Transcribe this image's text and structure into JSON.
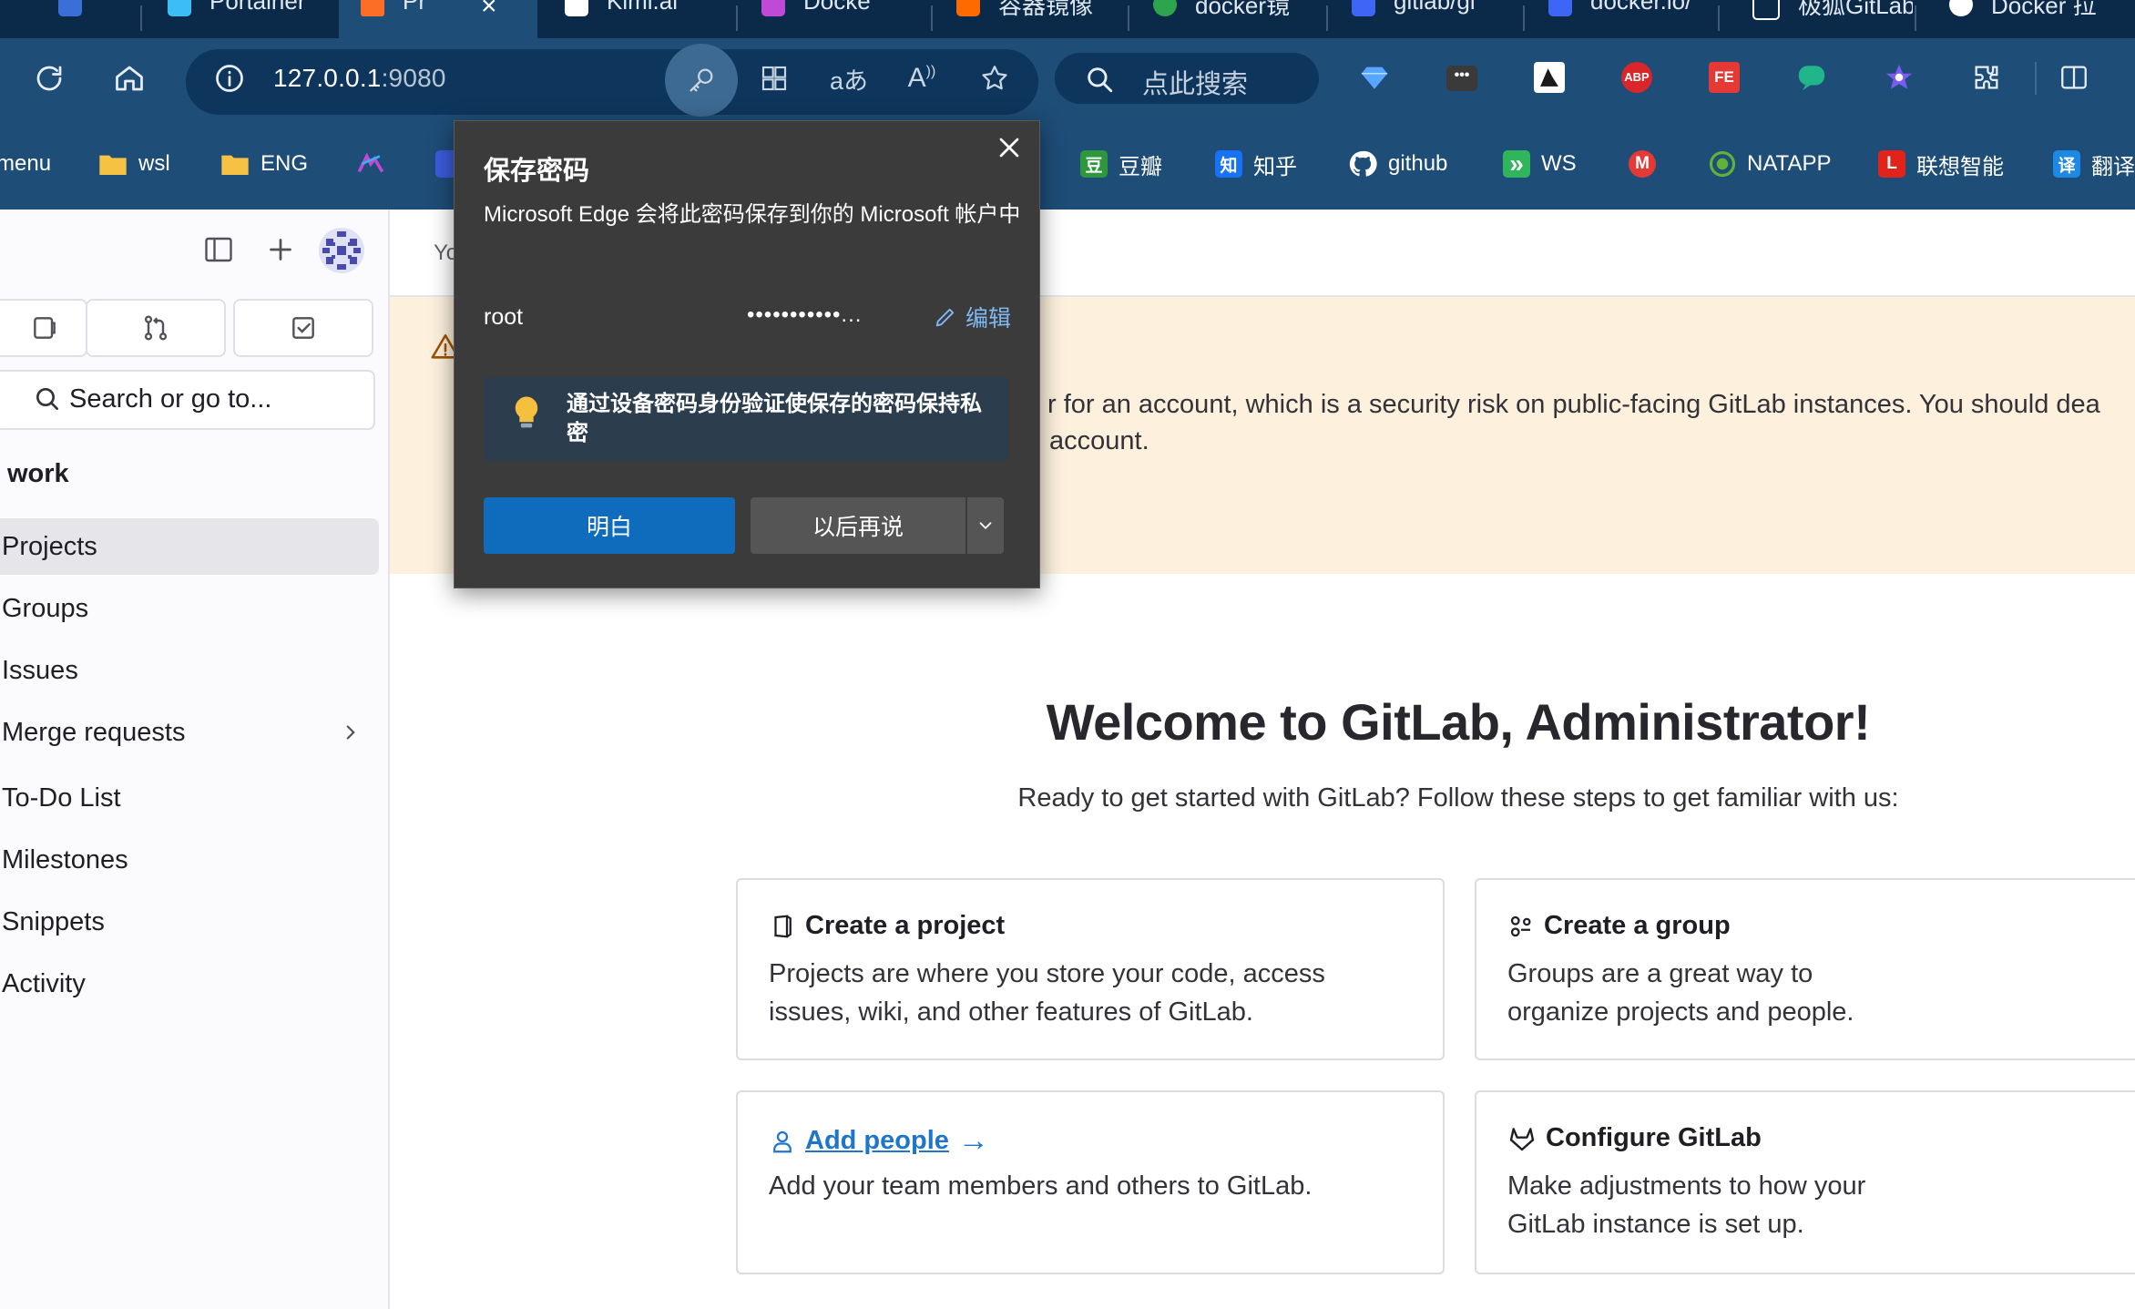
{
  "browser": {
    "tabs": [
      {
        "label": "Portainer",
        "color": "#3dbdf5"
      },
      {
        "label": "Pr",
        "color": "#fc6d26",
        "active": true
      },
      {
        "label": "Kimi.ai",
        "color": "#ffffff"
      },
      {
        "label": "",
        "color": "#c04ad8"
      },
      {
        "label": "Docke",
        "color": "#f7a21b"
      },
      {
        "label": "容器镜像",
        "color": "#ff6a00"
      },
      {
        "label": "docker镜",
        "color": "#2da44e"
      },
      {
        "label": "gitlab/gi",
        "color": "#3e66f6"
      },
      {
        "label": "docker.io/",
        "color": "#3e66f6"
      },
      {
        "label": "极狐GitLab",
        "color": "#ffffff"
      },
      {
        "label": "Docker 拉",
        "color": "#ffffff"
      }
    ],
    "address": {
      "host": "127.0.0.1",
      "port": ":9080"
    },
    "search_placeholder": "点此搜索",
    "bookmarks": [
      {
        "label": "menu",
        "icon": "folder-icon",
        "color": "#f6c244"
      },
      {
        "label": "wsl",
        "icon": "folder-icon",
        "color": "#f6c244"
      },
      {
        "label": "ENG",
        "icon": "folder-icon",
        "color": "#f6c244"
      },
      {
        "label": "",
        "icon": "app-icon",
        "color": "#8f5bd9"
      },
      {
        "label": "",
        "icon": "app-icon",
        "color": "#3b5bdb"
      },
      {
        "label": "豆瓣",
        "icon": "douban-icon",
        "color": "#2e963d",
        "glyph": "豆"
      },
      {
        "label": "知乎",
        "icon": "zhihu-icon",
        "color": "#1772f6",
        "glyph": "知"
      },
      {
        "label": "github",
        "icon": "github-icon",
        "color": "#ffffff"
      },
      {
        "label": "WS",
        "icon": "ws-icon",
        "color": "#2fb55c",
        "glyph": "»"
      },
      {
        "label": "",
        "icon": "m-icon",
        "color": "#e53935",
        "glyph": "M"
      },
      {
        "label": "NATAPP",
        "icon": "natapp-icon",
        "color": "#5fb336"
      },
      {
        "label": "联想智能",
        "icon": "lenovo-icon",
        "color": "#e2231a",
        "glyph": "L"
      },
      {
        "label": "翻译",
        "icon": "translate-icon",
        "color": "#1e88e5",
        "glyph": "译"
      }
    ]
  },
  "sidebar": {
    "search_placeholder": "Search or go to...",
    "section_title": "work",
    "items": [
      {
        "label": "Projects",
        "active": true
      },
      {
        "label": "Groups"
      },
      {
        "label": "Issues"
      },
      {
        "label": "Merge requests",
        "has_chevron": true
      },
      {
        "label": "To-Do List"
      },
      {
        "label": "Milestones"
      },
      {
        "label": "Snippets"
      },
      {
        "label": "Activity"
      }
    ]
  },
  "main": {
    "crumb": "Yo",
    "alert_line1": "r for an account, which is a security risk on public-facing GitLab instances. You should dea",
    "alert_line2": "account.",
    "welcome_title": "Welcome to GitLab, Administrator!",
    "welcome_subtitle": "Ready to get started with GitLab? Follow these steps to get familiar with us:",
    "cards": [
      {
        "title": "Create a project",
        "desc": "Projects are where you store your code, access issues, wiki, and other features of GitLab."
      },
      {
        "title": "Create a group",
        "desc": "Groups are a great way to organize projects and people."
      },
      {
        "title": "Add people",
        "arrow": "→",
        "desc": "Add your team members and others to GitLab."
      },
      {
        "title": "Configure GitLab",
        "desc": "Make adjustments to how your GitLab instance is set up."
      }
    ]
  },
  "popup": {
    "title": "保存密码",
    "description": "Microsoft Edge 会将此密码保存到你的 Microsoft 帐户中",
    "username": "root",
    "password_mask": "•••••••••••...",
    "edit_label": "编辑",
    "tip": "通过设备密码身份验证使保存的密码保持私密",
    "ok_label": "明白",
    "later_label": "以后再说"
  },
  "colors": {
    "chrome_dark": "#0b2a49",
    "chrome": "#1e4d78",
    "alert_bg": "#fdf1dd",
    "link": "#1f75cb",
    "primary_button": "#0f6cbd"
  }
}
